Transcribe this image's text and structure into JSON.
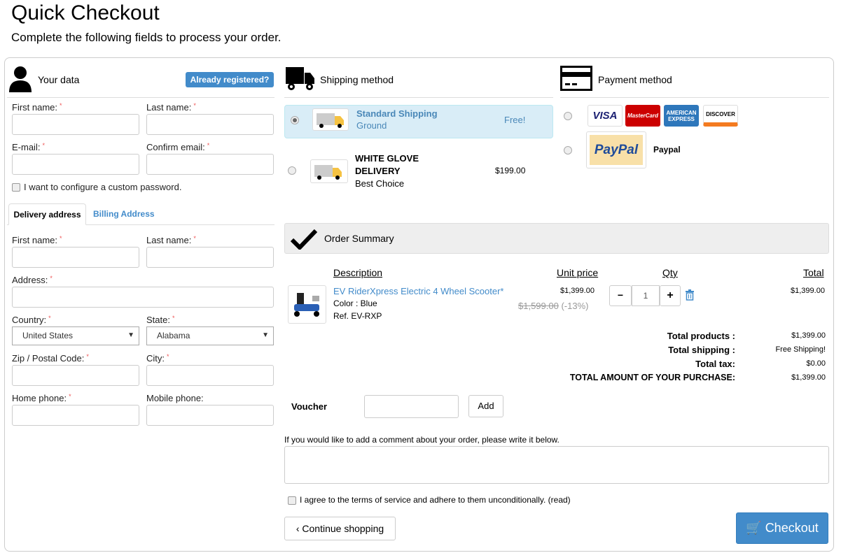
{
  "page": {
    "title": "Quick Checkout",
    "subtitle": "Complete the following fields to process your order."
  },
  "your_data": {
    "title": "Your data",
    "icon": "user-icon",
    "already_registered": "Already registered?",
    "first_name": "First name:",
    "last_name": "Last name:",
    "email": "E-mail:",
    "confirm_email": "Confirm email:",
    "custom_password": "I want to configure a custom password."
  },
  "address_tabs": [
    {
      "label": "Delivery address",
      "active": true
    },
    {
      "label": "Billing Address",
      "active": false
    }
  ],
  "address": {
    "first_name": "First name:",
    "last_name": "Last name:",
    "address": "Address:",
    "country": "Country:",
    "country_value": "United States",
    "state": "State:",
    "state_value": "Alabama",
    "zip": "Zip / Postal Code:",
    "city": "City:",
    "home_phone": "Home phone:",
    "mobile_phone": "Mobile phone:"
  },
  "shipping": {
    "title": "Shipping method",
    "icon": "truck-icon",
    "options": [
      {
        "name": "Standard Shipping",
        "desc": "Ground",
        "price": "Free!",
        "selected": true
      },
      {
        "name": "WHITE GLOVE DELIVERY",
        "desc": "Best Choice",
        "price": "$199.00",
        "selected": false
      }
    ]
  },
  "payment": {
    "title": "Payment method",
    "icon": "credit-card-icon",
    "options": [
      {
        "cards": [
          "VISA",
          "MasterCard",
          "AMERICAN EXPRESS",
          "DISCOVER"
        ],
        "selected": false
      },
      {
        "logo": "PayPal",
        "label": "Paypal",
        "selected": false
      }
    ]
  },
  "summary": {
    "title": "Order Summary",
    "icon": "checkmark-icon",
    "columns": {
      "description": "Description",
      "unit_price": "Unit price",
      "qty": "Qty",
      "total": "Total"
    },
    "items": [
      {
        "name": "EV RiderXpress Electric 4 Wheel Scooter*",
        "color": "Color : Blue",
        "ref": "Ref. EV-RXP",
        "price": "$1,399.00",
        "old_price": "$1,599.00",
        "discount": "(-13%)",
        "qty": "1",
        "total": "$1,399.00"
      }
    ],
    "totals": [
      {
        "label": "Total products :",
        "value": "$1,399.00"
      },
      {
        "label": "Total shipping :",
        "value": "Free Shipping!"
      },
      {
        "label": "Total tax:",
        "value": "$0.00"
      },
      {
        "label": "TOTAL AMOUNT OF YOUR PURCHASE:",
        "value": "$1,399.00"
      }
    ]
  },
  "voucher": {
    "label": "Voucher",
    "add": "Add"
  },
  "comment": {
    "label": "If you would like to add a comment about your order, please write it below."
  },
  "terms": {
    "label": "I agree to the terms of service and adhere to them unconditionally.",
    "read": "(read)"
  },
  "actions": {
    "continue": "Continue shopping",
    "checkout": "Checkout"
  },
  "colors": {
    "accent": "#428bca",
    "selected_bg": "#d9edf7"
  }
}
